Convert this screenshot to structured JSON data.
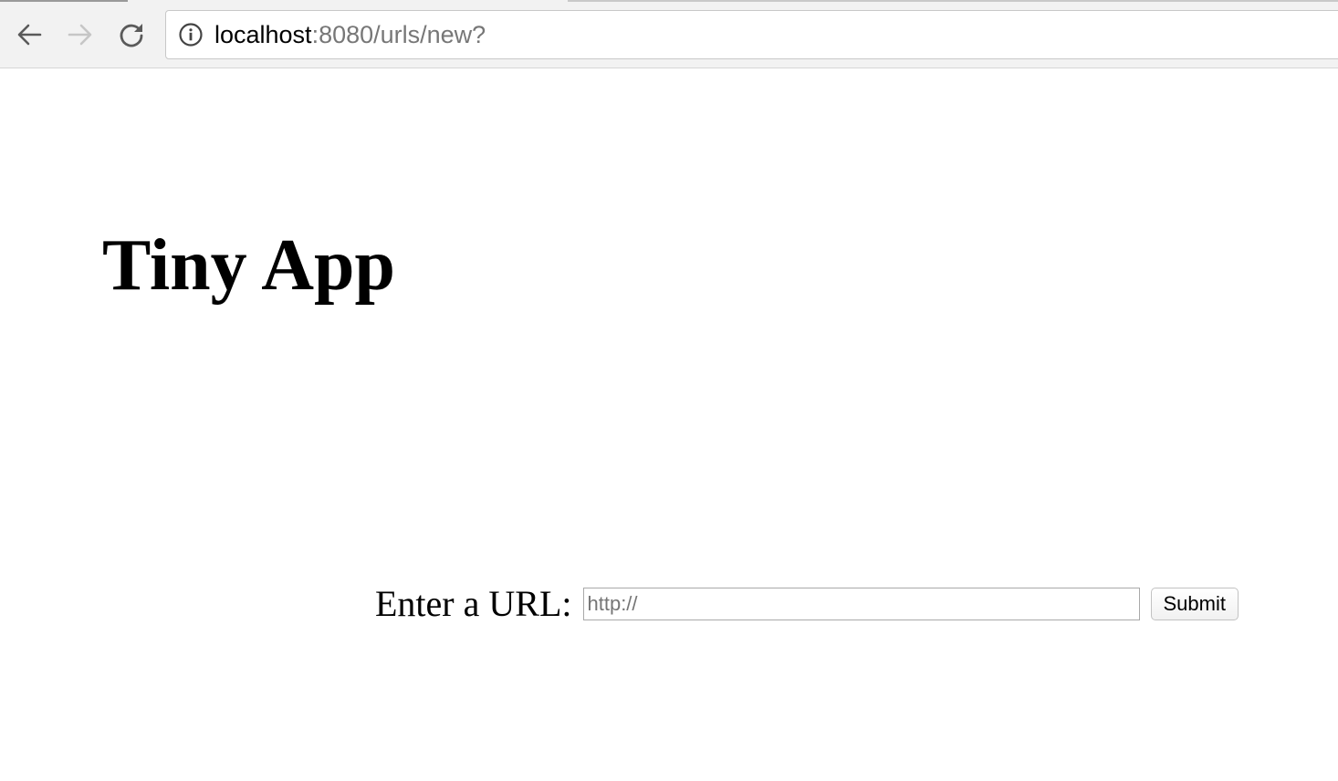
{
  "browser": {
    "url_host": "localhost",
    "url_rest": ":8080/urls/new?"
  },
  "icons": {
    "back": "back-arrow-icon",
    "forward": "forward-arrow-icon",
    "reload": "reload-icon",
    "info": "info-icon"
  },
  "colors": {
    "toolbar_bg": "#f2f2f2",
    "url_rest": "#777777",
    "forward_disabled": "#c6c6c6"
  },
  "page": {
    "title": "Tiny App",
    "form": {
      "label": "Enter a URL:",
      "input_value": "",
      "input_placeholder": "http://",
      "submit_label": "Submit"
    }
  }
}
